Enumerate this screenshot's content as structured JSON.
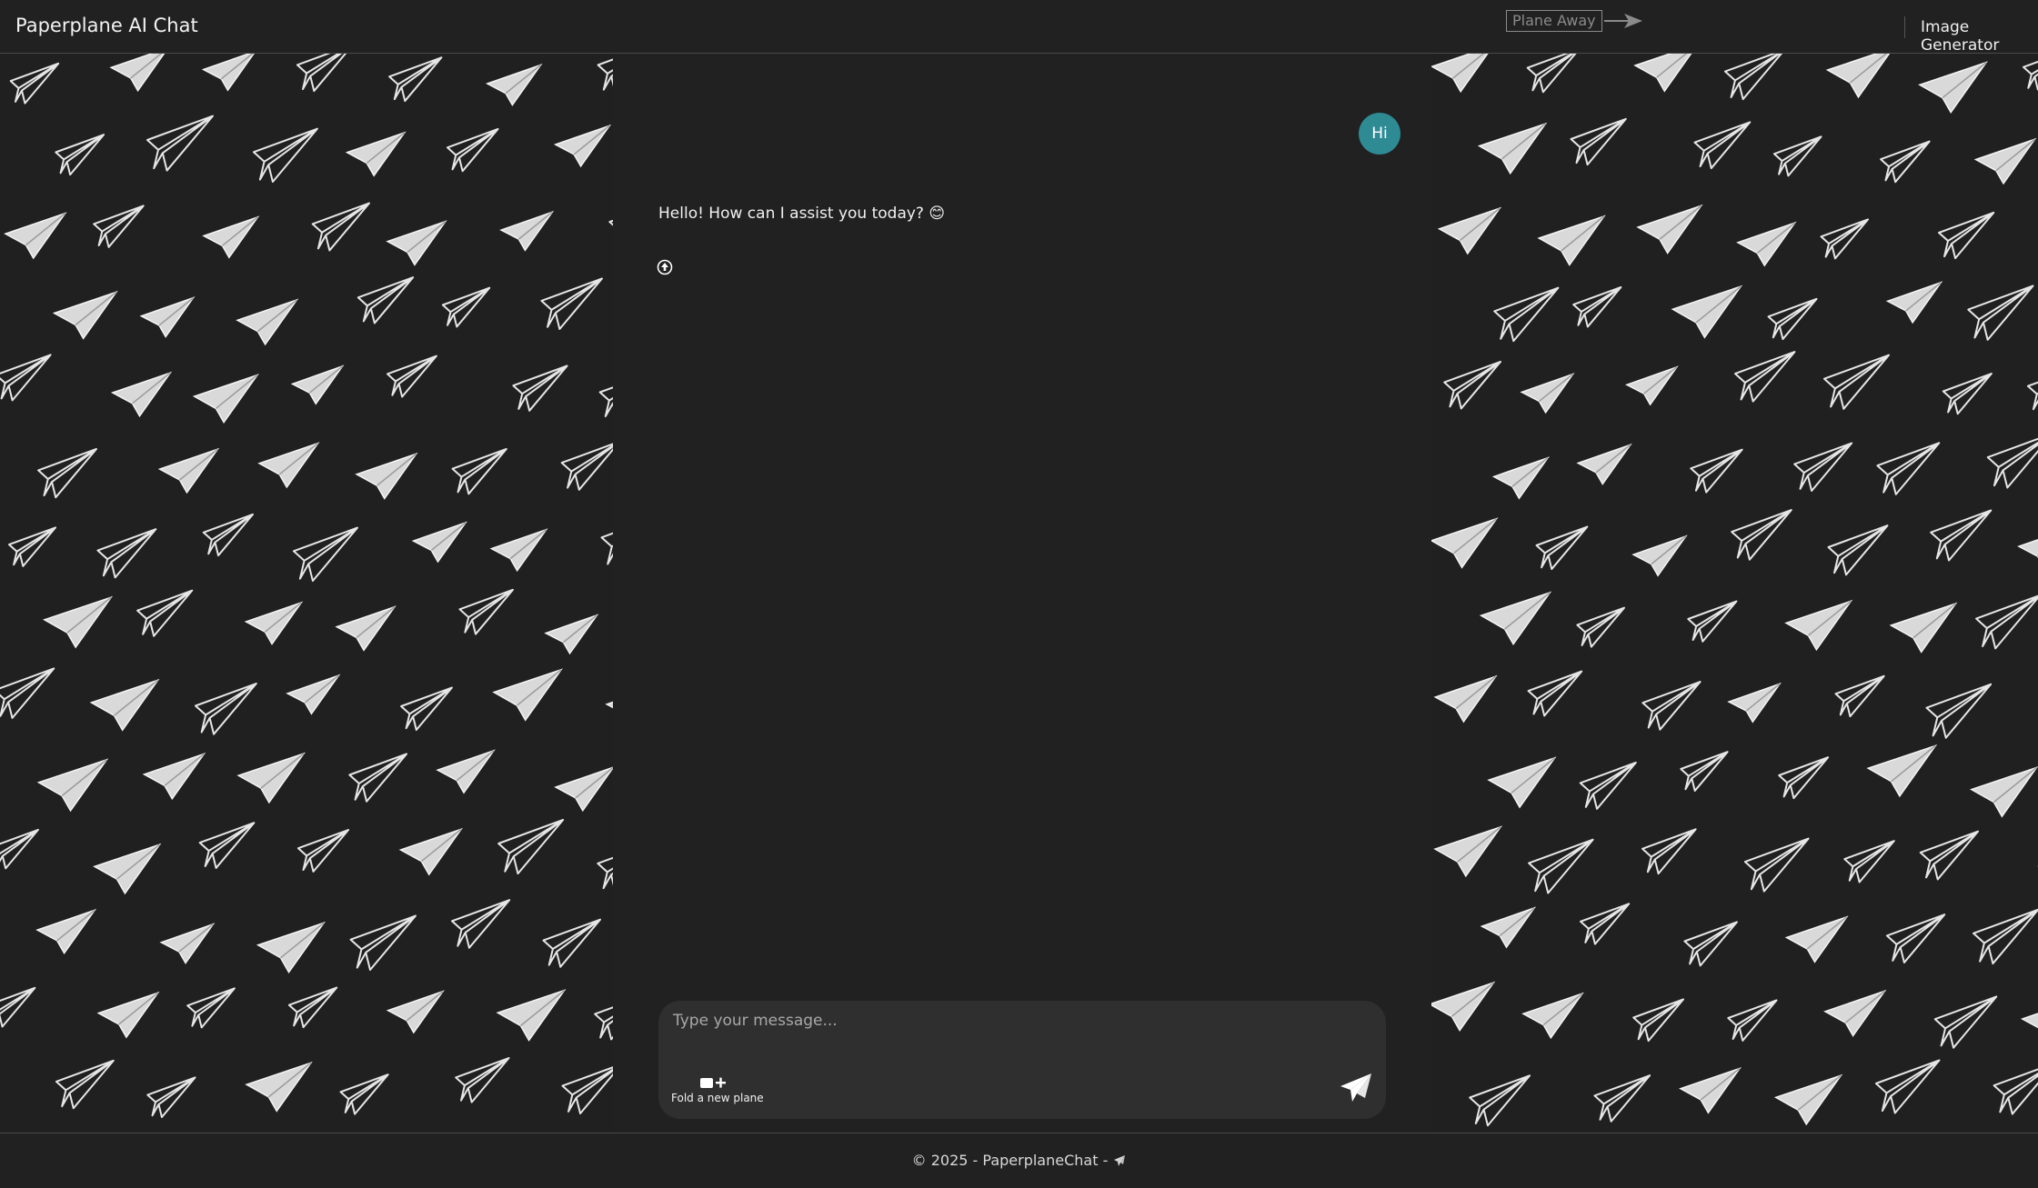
{
  "navbar": {
    "brand": "Paperplane AI Chat",
    "plane_away_label": "Plane Away",
    "image_generator_label": "Image Generator"
  },
  "chat": {
    "messages": [
      {
        "role": "user",
        "text": "Hi"
      },
      {
        "role": "assistant",
        "text": "Hello! How can I assist you today? 😊"
      }
    ]
  },
  "composer": {
    "placeholder": "Type your message...",
    "value": "",
    "fold_label": "Fold a new plane"
  },
  "footer": {
    "text": "© 2025 - PaperplaneChat -"
  },
  "colors": {
    "background": "#202020",
    "user_bubble": "#2e8b94",
    "composer": "#2f2f2f"
  },
  "icons": {
    "scroll_top": "arrow-up-circle-icon",
    "fold": "new-chat-icon",
    "send": "paper-plane-icon",
    "footer": "paper-plane-icon",
    "plane_away": "arrow-right-icon"
  }
}
